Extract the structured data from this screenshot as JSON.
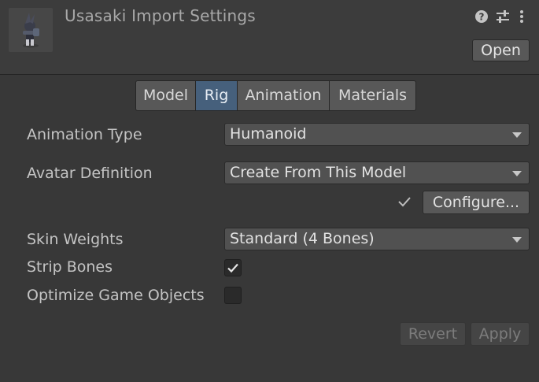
{
  "header": {
    "title": "Usasaki Import Settings",
    "open_label": "Open",
    "icons": [
      "help-icon",
      "presets-icon",
      "more-menu-icon"
    ],
    "thumbnail": "model-preview-thumbnail"
  },
  "tabs": [
    {
      "label": "Model",
      "active": false
    },
    {
      "label": "Rig",
      "active": true
    },
    {
      "label": "Animation",
      "active": false
    },
    {
      "label": "Materials",
      "active": false
    }
  ],
  "rig": {
    "animation_type": {
      "label": "Animation Type",
      "value": "Humanoid"
    },
    "avatar_definition": {
      "label": "Avatar Definition",
      "value": "Create From This Model"
    },
    "configure_label": "Configure...",
    "skin_weights": {
      "label": "Skin Weights",
      "value": "Standard (4 Bones)"
    },
    "strip_bones": {
      "label": "Strip Bones",
      "checked": true
    },
    "optimize_game_objects": {
      "label": "Optimize Game Objects",
      "checked": false
    }
  },
  "footer": {
    "revert_label": "Revert",
    "apply_label": "Apply"
  },
  "colors": {
    "background": "#383838",
    "active_tab": "#46607c",
    "button": "#585858"
  }
}
